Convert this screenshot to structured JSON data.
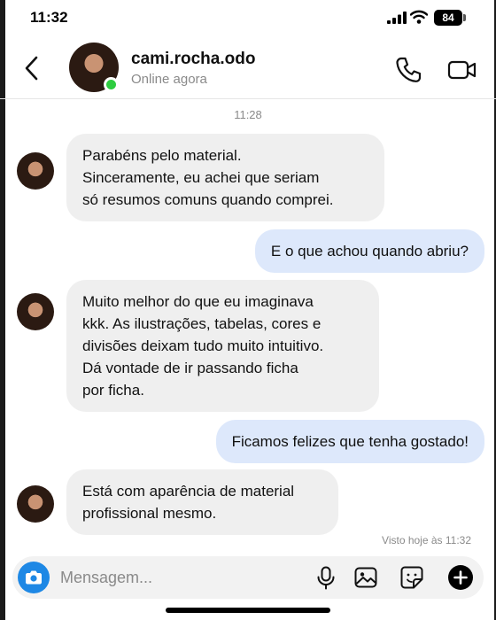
{
  "status_bar": {
    "time": "11:32",
    "battery": "84"
  },
  "header": {
    "name": "cami.rocha.odo",
    "status": "Online agora"
  },
  "conversation": {
    "timestamp": "11:28",
    "messages": [
      {
        "direction": "in",
        "text": "Parabéns pelo material.\nSinceramente, eu achei que seriam\nsó resumos comuns quando comprei."
      },
      {
        "direction": "out",
        "text": "E o que achou quando abriu?"
      },
      {
        "direction": "in",
        "text": "Muito melhor do que eu imaginava\nkkk. As ilustrações, tabelas, cores e\ndivisões deixam tudo muito intuitivo.\nDá vontade de ir passando ficha\npor ficha."
      },
      {
        "direction": "out",
        "text": "Ficamos felizes que tenha gostado!"
      },
      {
        "direction": "in",
        "text": "Está com aparência de material\nprofissional mesmo."
      }
    ],
    "seen": "Visto hoje às 11:32"
  },
  "composer": {
    "placeholder": "Mensagem..."
  },
  "colors": {
    "accent": "#1e88e5",
    "incoming_bubble": "#efefef",
    "outgoing_bubble": "#dde8fb",
    "online": "#2ecc40"
  },
  "icons": [
    "back-icon",
    "phone-icon",
    "video-icon",
    "camera-icon",
    "microphone-icon",
    "image-icon",
    "sticker-icon",
    "plus-icon"
  ]
}
